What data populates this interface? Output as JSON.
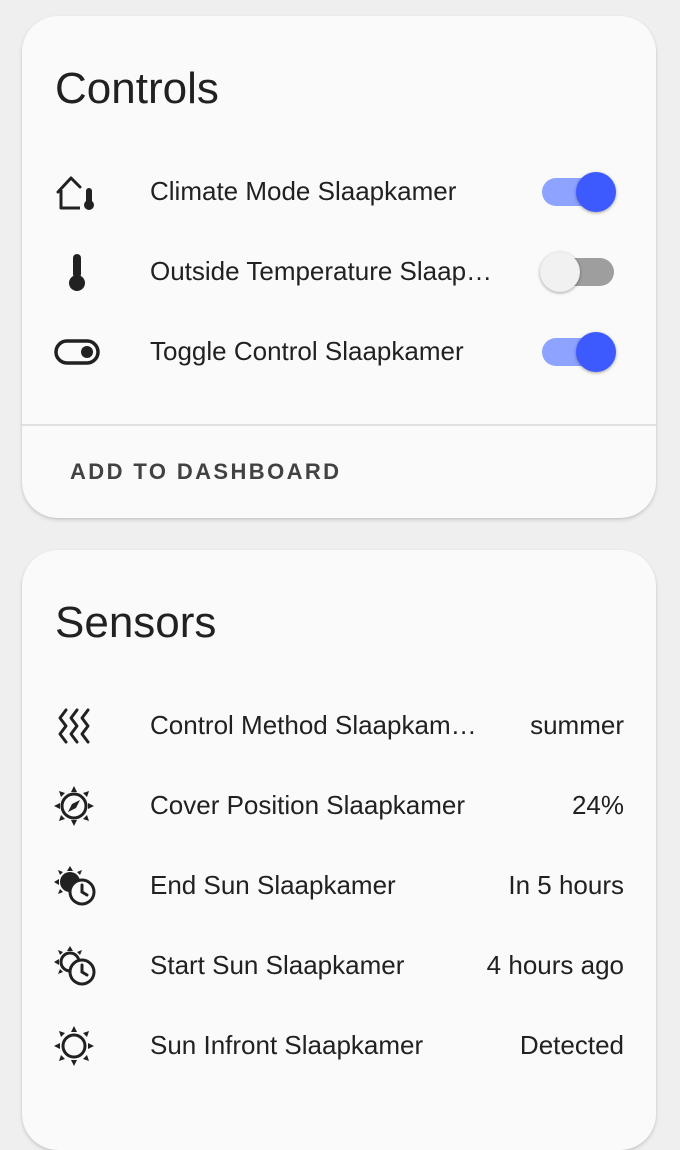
{
  "controls": {
    "title": "Controls",
    "items": [
      {
        "label": "Climate Mode Slaapkamer",
        "icon": "home-thermometer-icon",
        "state": "on"
      },
      {
        "label": "Outside Temperature Slaap…",
        "icon": "thermometer-icon",
        "state": "off"
      },
      {
        "label": "Toggle Control Slaapkamer",
        "icon": "toggle-switch-icon",
        "state": "on"
      }
    ],
    "action_label": "ADD TO DASHBOARD"
  },
  "sensors": {
    "title": "Sensors",
    "items": [
      {
        "label": "Control Method Slaapkam…",
        "value": "summer",
        "icon": "heat-waves-icon"
      },
      {
        "label": "Cover Position Slaapkamer",
        "value": "24%",
        "icon": "sun-compass-icon"
      },
      {
        "label": "End Sun Slaapkamer",
        "value": "In 5 hours",
        "icon": "sun-clock-icon"
      },
      {
        "label": "Start Sun Slaapkamer",
        "value": "4 hours ago",
        "icon": "sun-clock-outline-icon"
      },
      {
        "label": "Sun Infront Slaapkamer",
        "value": "Detected",
        "icon": "sun-icon"
      }
    ]
  },
  "colors": {
    "accent": "#3d5afe",
    "accent_track": "#8ea2ff",
    "background": "#efefef",
    "card": "#fafafa"
  }
}
